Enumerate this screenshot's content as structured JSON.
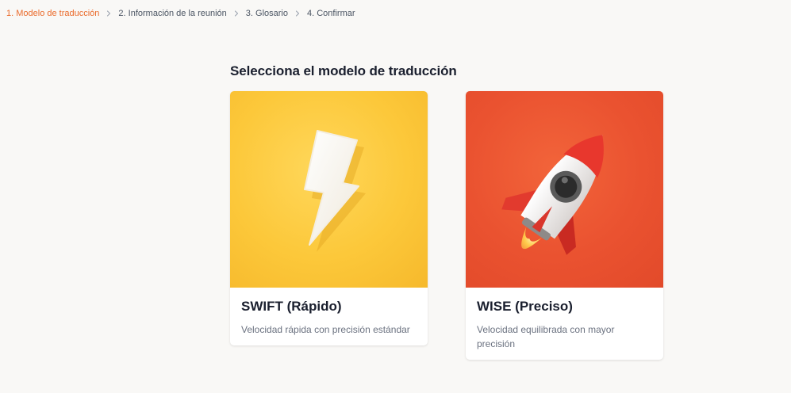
{
  "stepper": {
    "steps": [
      {
        "label": "1. Modelo de traducción",
        "active": true
      },
      {
        "label": "2. Información de la reunión",
        "active": false
      },
      {
        "label": "3. Glosario",
        "active": false
      },
      {
        "label": "4. Confirmar",
        "active": false
      }
    ]
  },
  "page": {
    "title": "Selecciona el modelo de traducción"
  },
  "models": [
    {
      "title": "SWIFT (Rápido)",
      "description": "Velocidad rápida con precisión estándar",
      "icon": "lightning-bolt-icon",
      "bg_color": "#fcc83a"
    },
    {
      "title": "WISE (Preciso)",
      "description": "Velocidad equilibrada con mayor precisión",
      "icon": "rocket-icon",
      "bg_color": "#ea5230"
    }
  ],
  "colors": {
    "accent": "#ea6a2a",
    "background": "#f9f8f6"
  }
}
